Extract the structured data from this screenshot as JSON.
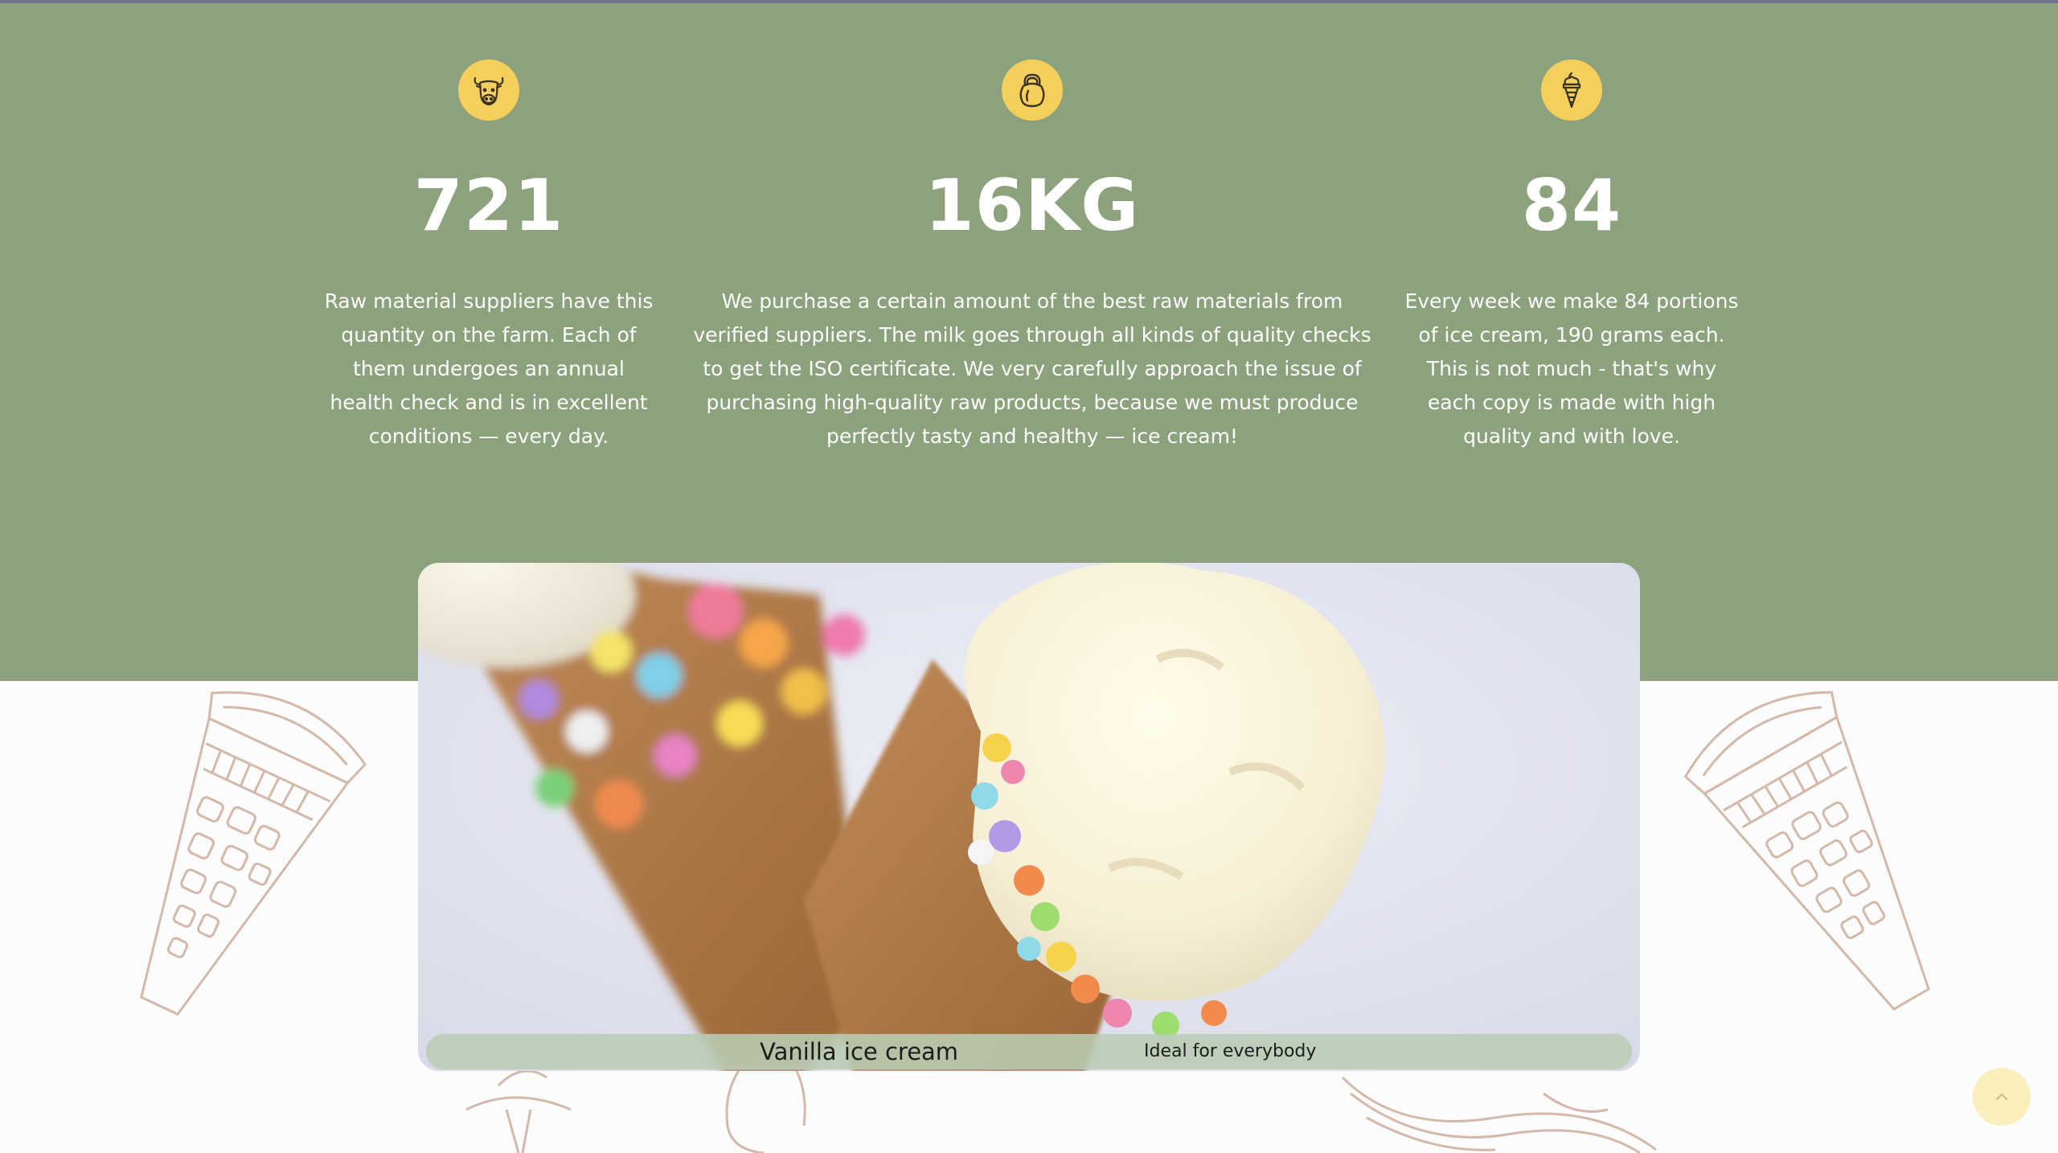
{
  "stats": [
    {
      "icon": "cow-icon",
      "value": "721",
      "text": "Raw material suppliers have this quantity on the farm. Each of them undergoes an annual health check and is in excellent conditions — every day."
    },
    {
      "icon": "kettlebell-icon",
      "value": "16KG",
      "text": "We purchase a certain amount of the best raw materials from verified suppliers. The milk goes through all kinds of quality checks to get the ISO certificate. We very carefully approach the issue of purchasing high-quality raw products, because we must produce perfectly tasty and healthy — ice cream!"
    },
    {
      "icon": "ice-cream-icon",
      "value": "84",
      "text": "Every week we make 84 portions of ice cream, 190 grams each. This is not much - that's why each copy is made with high quality and with love."
    }
  ],
  "product": {
    "title": "Vanilla ice cream",
    "subtitle": "Ideal for everybody"
  },
  "scroll_top": {
    "icon": "chevron-up-icon"
  },
  "colors": {
    "band": "#8ba27c",
    "icon_circle": "#f5cf5c",
    "caption_bar": "#baccb4",
    "scroll_button": "#fbeebd",
    "sketch": "#d4b8a8"
  }
}
